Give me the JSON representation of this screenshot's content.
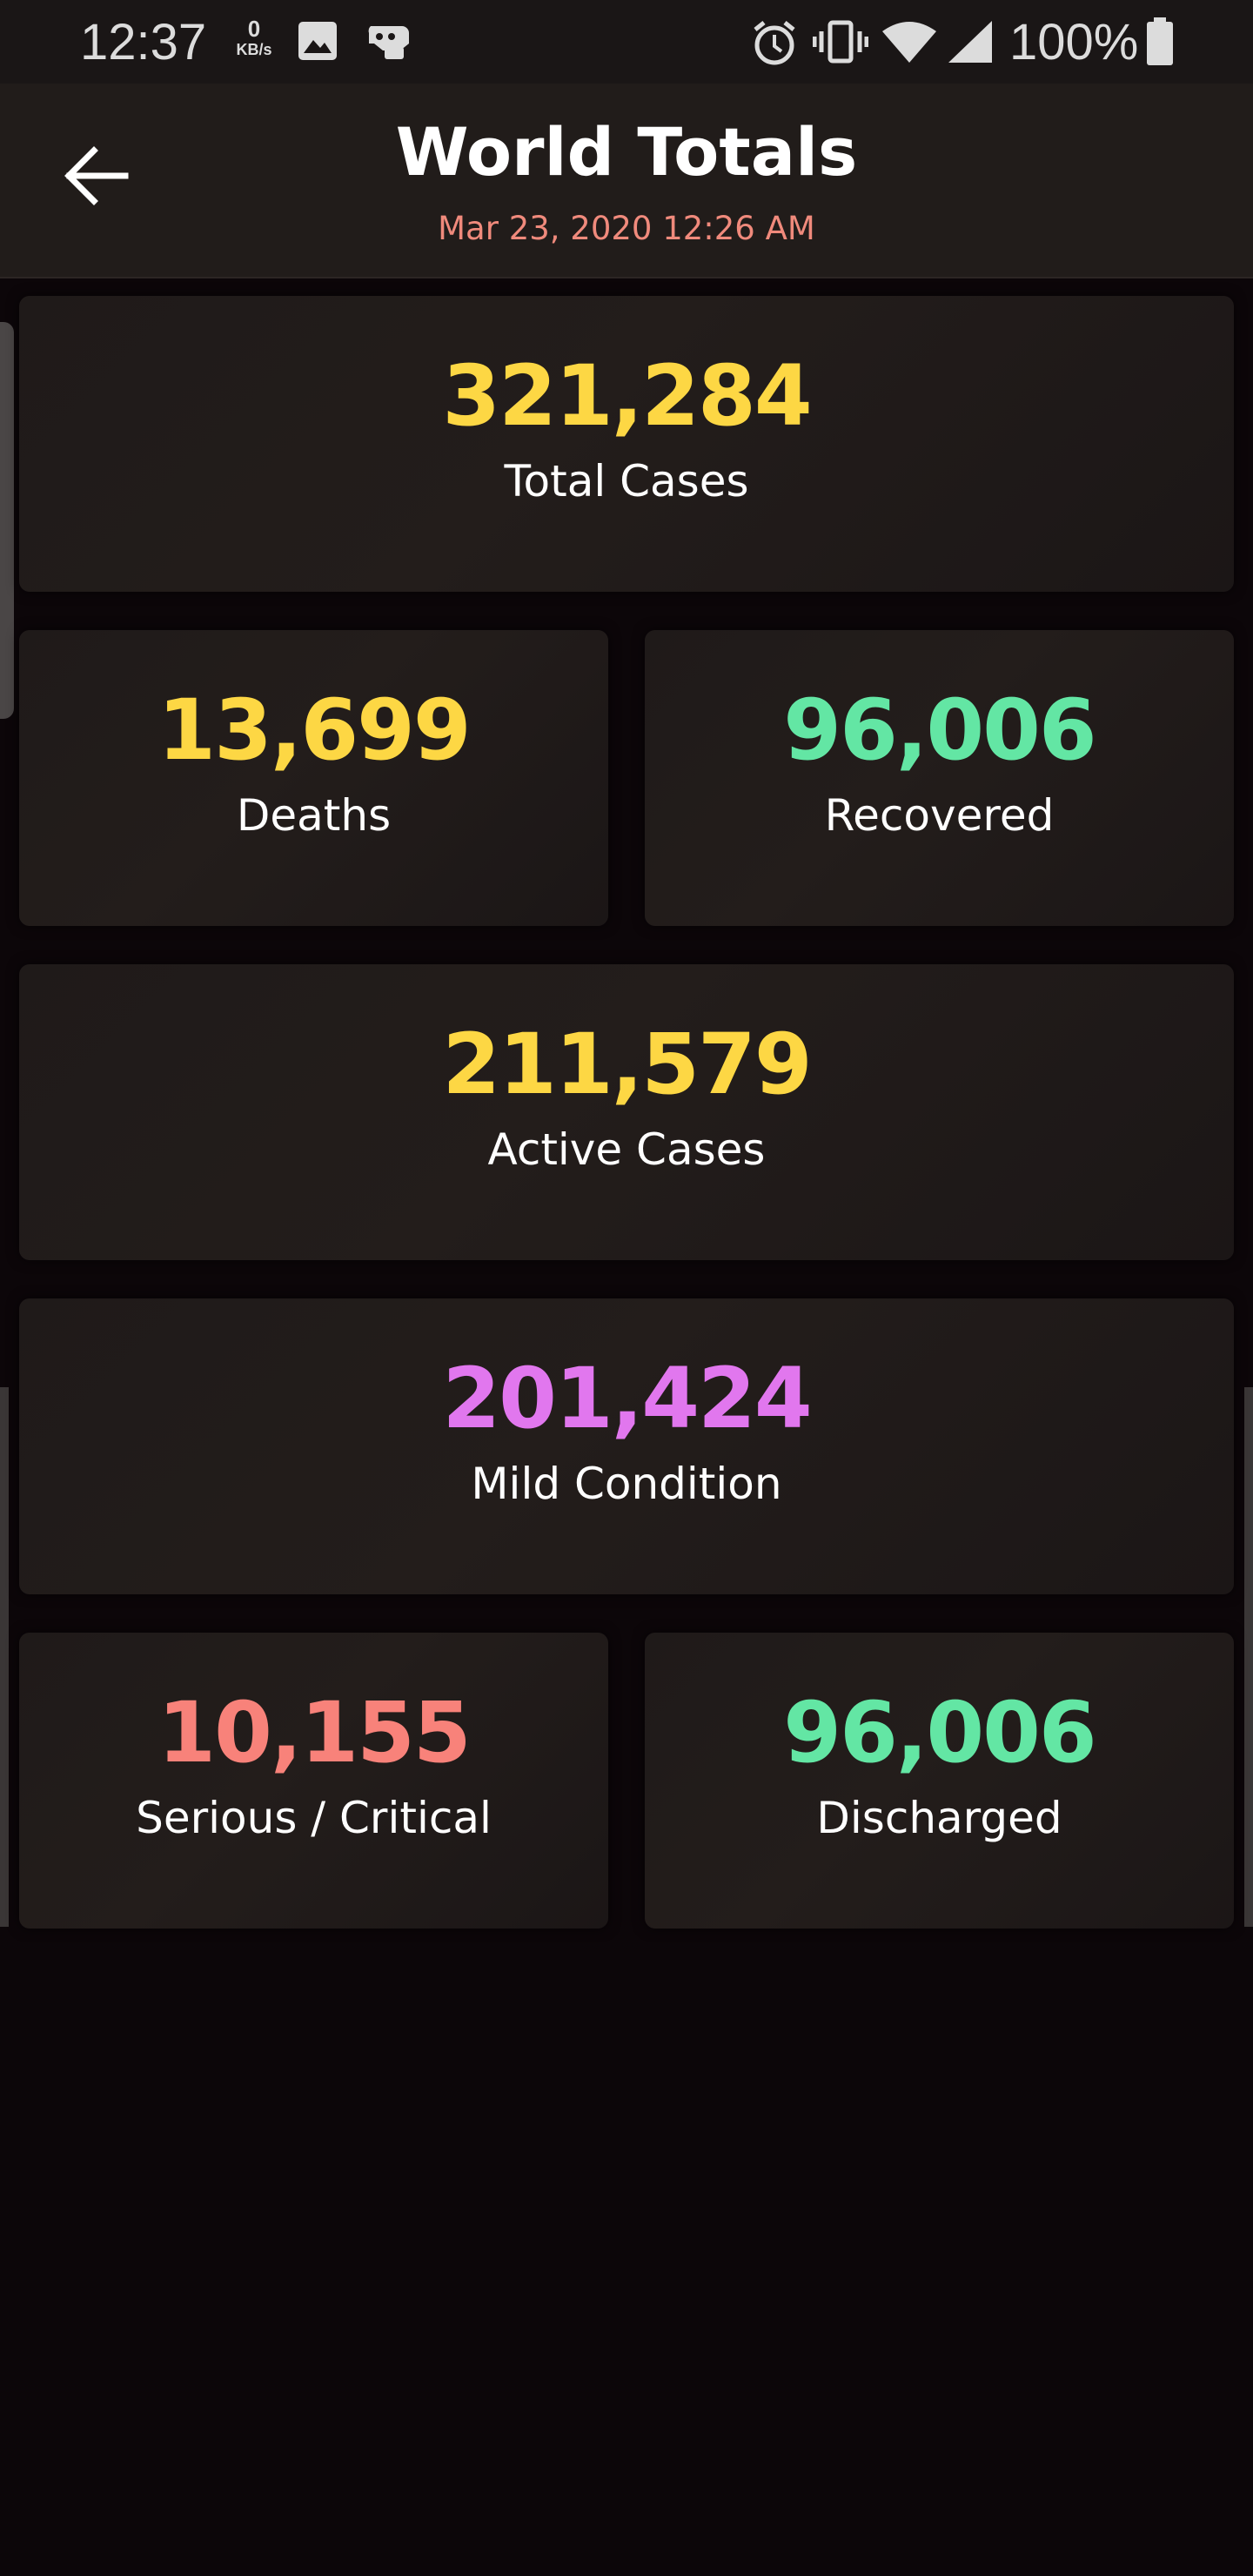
{
  "status_bar": {
    "time": "12:37",
    "net_speed_value": "0",
    "net_speed_unit": "KB/s",
    "battery": "100%",
    "icons": [
      "image-icon",
      "game-icon",
      "alarm-icon",
      "vibrate-icon",
      "wifi-icon",
      "signal-icon",
      "battery-icon"
    ]
  },
  "header": {
    "back_icon": "arrow-left-icon",
    "title": "World Totals",
    "subtitle": "Mar 23, 2020 12:26 AM"
  },
  "stats": {
    "total_cases": {
      "value": "321,284",
      "label": "Total Cases"
    },
    "deaths": {
      "value": "13,699",
      "label": "Deaths"
    },
    "recovered": {
      "value": "96,006",
      "label": "Recovered"
    },
    "active_cases": {
      "value": "211,579",
      "label": "Active Cases"
    },
    "mild_condition": {
      "value": "201,424",
      "label": "Mild Condition"
    },
    "serious_critical": {
      "value": "10,155",
      "label": "Serious / Critical"
    },
    "discharged": {
      "value": "96,006",
      "label": "Discharged"
    }
  },
  "colors": {
    "background": "#0c0609",
    "card": "#211c1a",
    "yellow": "#fdd744",
    "green": "#63e6a4",
    "purple": "#e177ee",
    "salmon": "#f8827a",
    "subtitle": "#f08a7c"
  }
}
